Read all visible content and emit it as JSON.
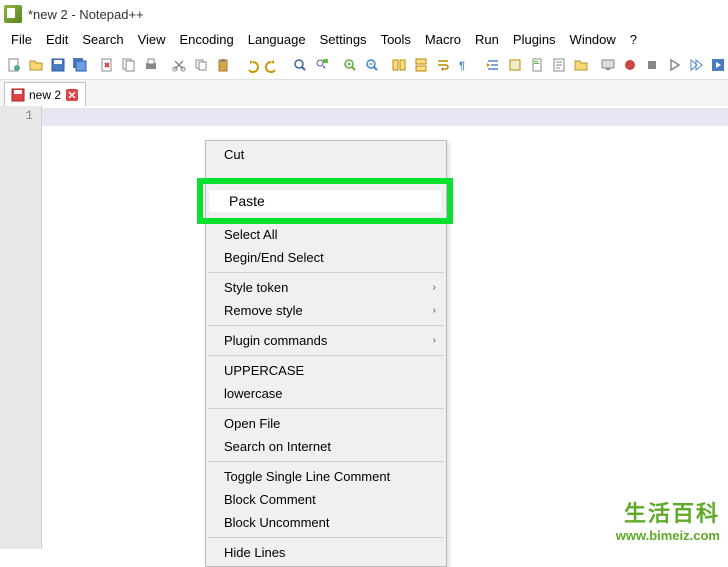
{
  "window": {
    "title": "*new 2 - Notepad++"
  },
  "menu": {
    "file": "File",
    "edit": "Edit",
    "search": "Search",
    "view": "View",
    "encoding": "Encoding",
    "language": "Language",
    "settings": "Settings",
    "tools": "Tools",
    "macro": "Macro",
    "run": "Run",
    "plugins": "Plugins",
    "window": "Window",
    "help": "?"
  },
  "tab": {
    "name": "new 2"
  },
  "editor": {
    "line1": "1"
  },
  "context": {
    "cut": "Cut",
    "paste": "Paste",
    "select_all": "Select All",
    "begin_end_select": "Begin/End Select",
    "style_token": "Style token",
    "remove_style": "Remove style",
    "plugin_commands": "Plugin commands",
    "uppercase": "UPPERCASE",
    "lowercase": "lowercase",
    "open_file": "Open File",
    "search_internet": "Search on Internet",
    "toggle_comment": "Toggle Single Line Comment",
    "block_comment": "Block Comment",
    "block_uncomment": "Block Uncomment",
    "hide_lines": "Hide Lines"
  },
  "watermark": {
    "text": "生活百科",
    "url": "www.bimeiz.com"
  }
}
